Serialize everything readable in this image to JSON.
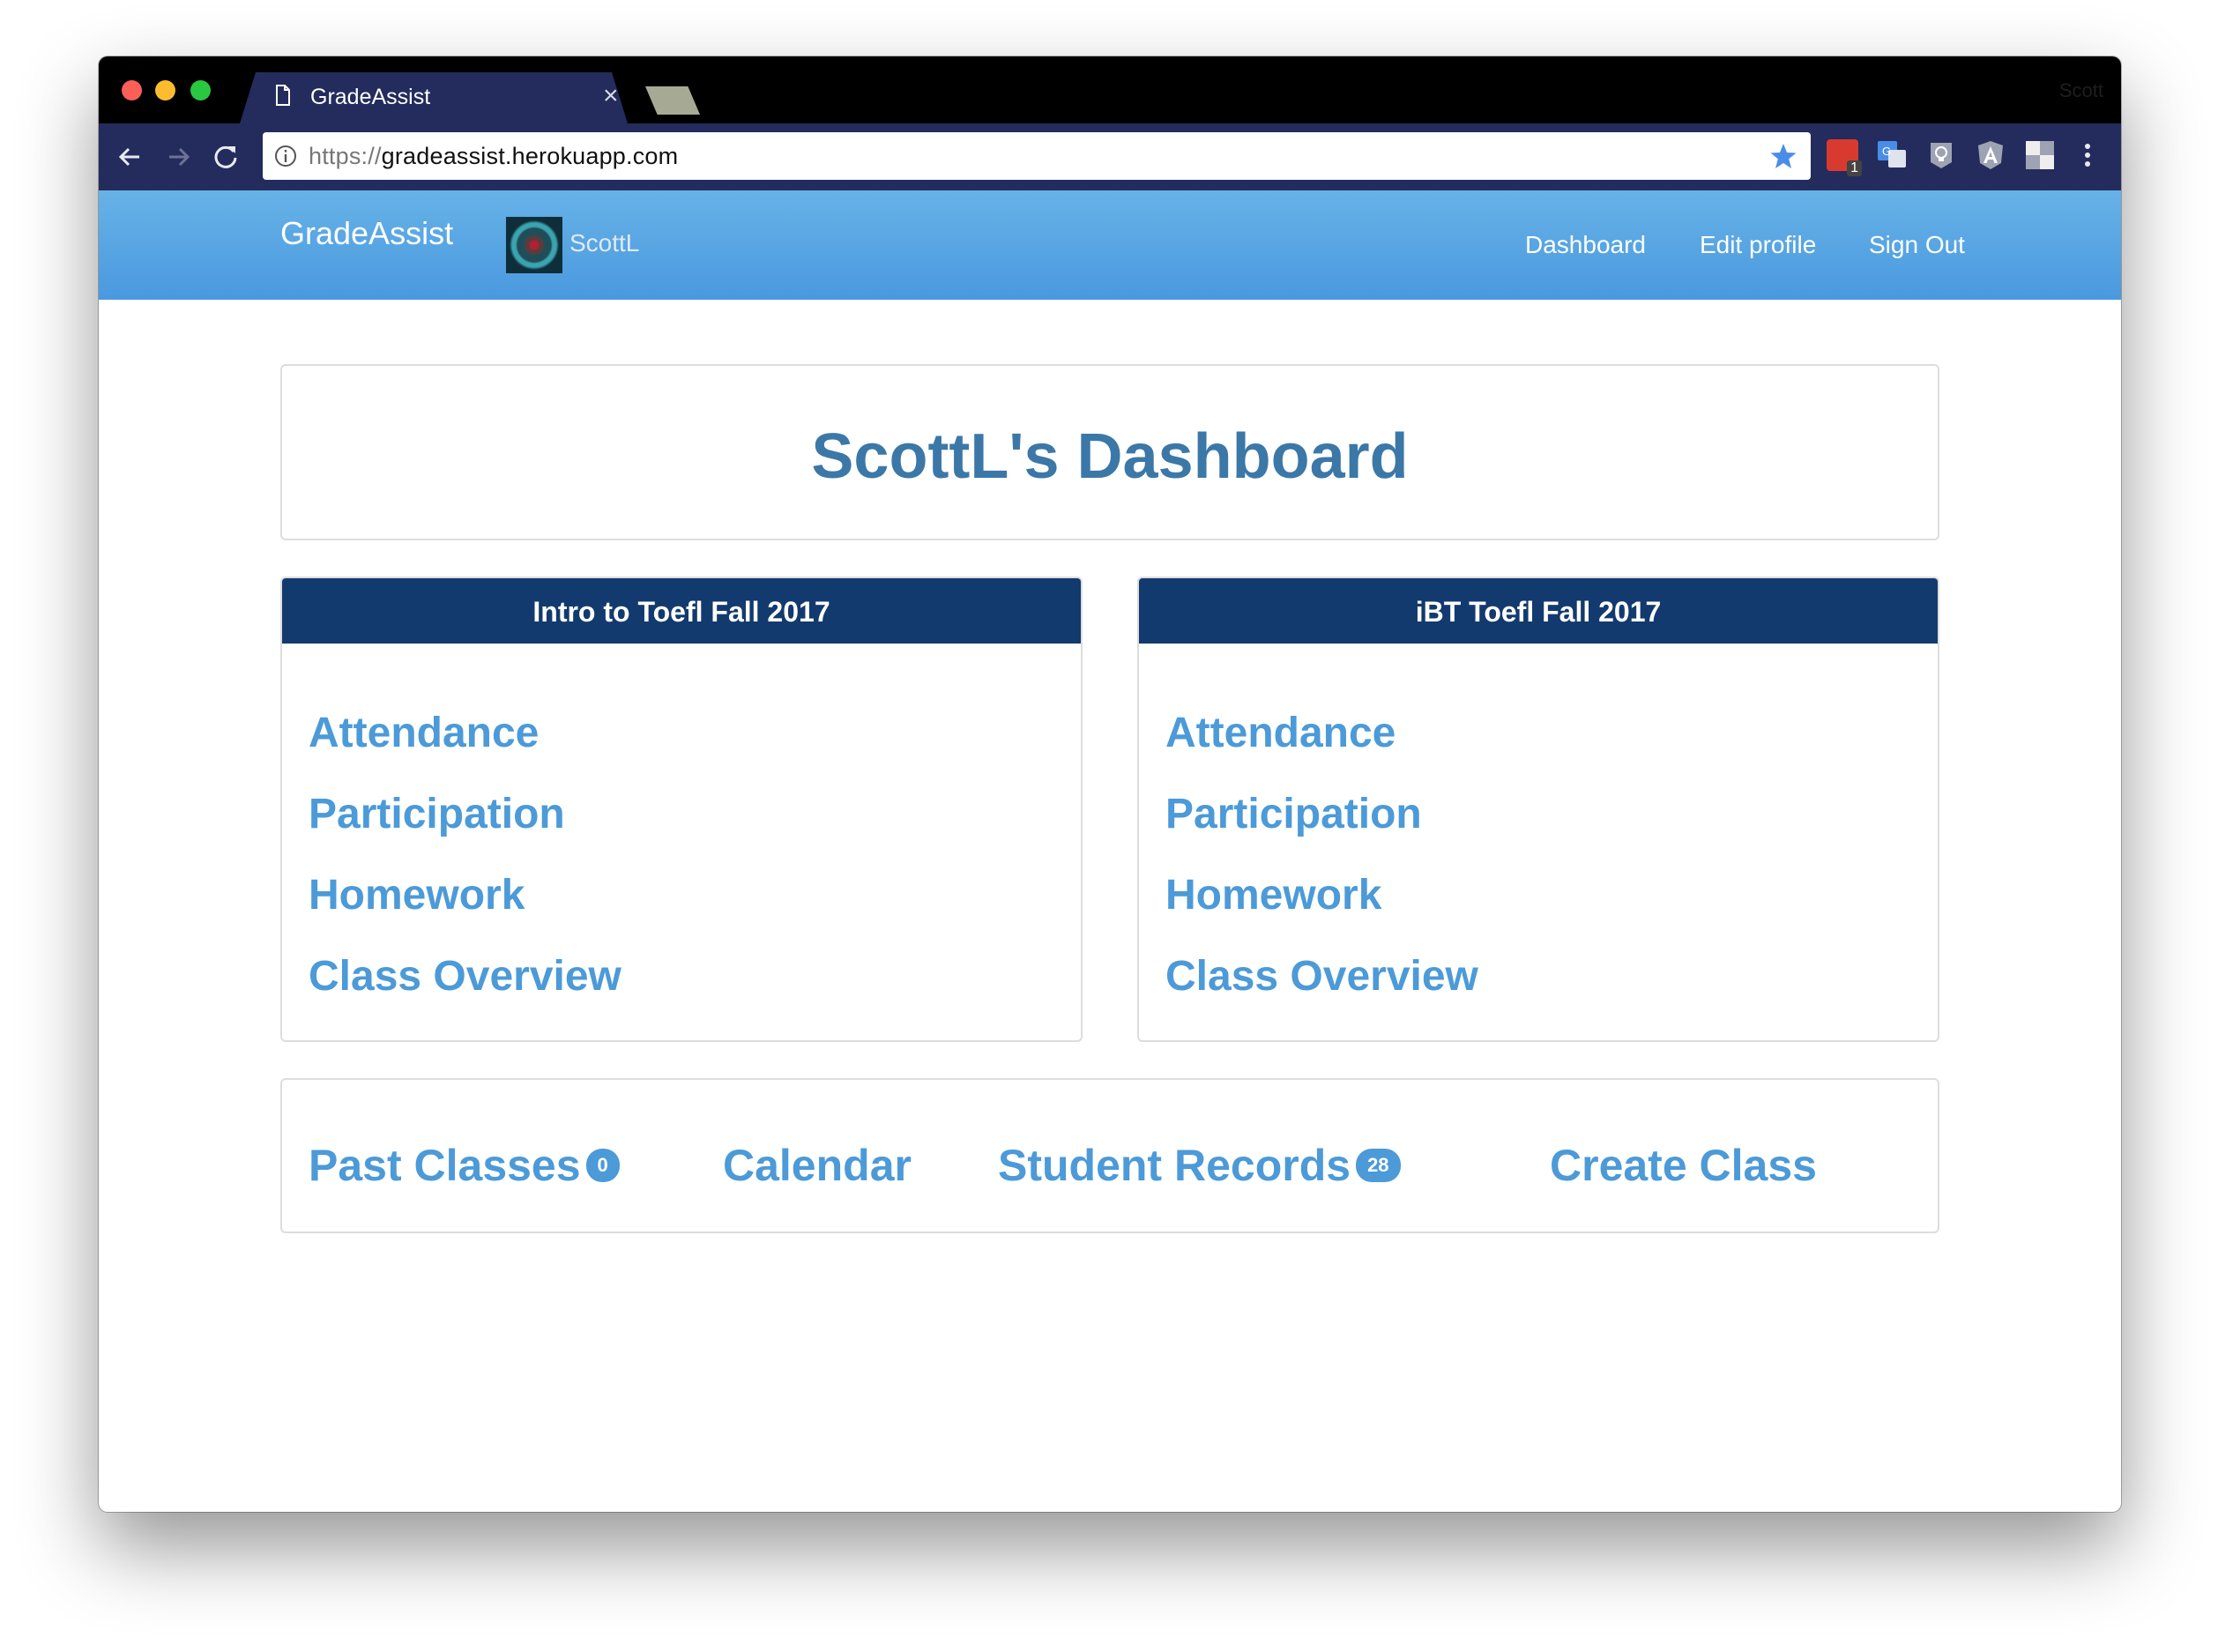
{
  "browser": {
    "tab_title": "GradeAssist",
    "tab_close": "×",
    "profile_name": "Scott",
    "url_scheme": "https://",
    "url_host": "gradeassist.herokuapp.com",
    "extension_badge": "1"
  },
  "navbar": {
    "brand": "GradeAssist",
    "username": "ScottL",
    "links": {
      "dashboard": "Dashboard",
      "edit_profile": "Edit profile",
      "sign_out": "Sign Out"
    }
  },
  "dashboard": {
    "title": "ScottL's Dashboard"
  },
  "classes": [
    {
      "name": "Intro to Toefl Fall 2017",
      "links": [
        "Attendance",
        "Participation",
        "Homework",
        "Class Overview"
      ]
    },
    {
      "name": "iBT Toefl Fall 2017",
      "links": [
        "Attendance",
        "Participation",
        "Homework",
        "Class Overview"
      ]
    }
  ],
  "bottom_links": {
    "past_classes": {
      "label": "Past Classes",
      "count": "0"
    },
    "calendar": {
      "label": "Calendar"
    },
    "student_records": {
      "label": "Student Records",
      "count": "28"
    },
    "create_class": {
      "label": "Create Class"
    }
  },
  "colors": {
    "navbar_gradient_top": "#67b2e7",
    "navbar_gradient_bottom": "#4a99df",
    "class_header": "#133a6e",
    "link": "#4c9ad8",
    "title": "#3b78a8",
    "browser_chrome": "#232c5c"
  },
  "icons": {
    "tab": "document-icon",
    "back": "back-arrow-icon",
    "forward": "forward-arrow-icon",
    "reload": "reload-icon",
    "site_info": "info-icon",
    "bookmark": "star-icon",
    "menu": "kebab-menu-icon"
  }
}
